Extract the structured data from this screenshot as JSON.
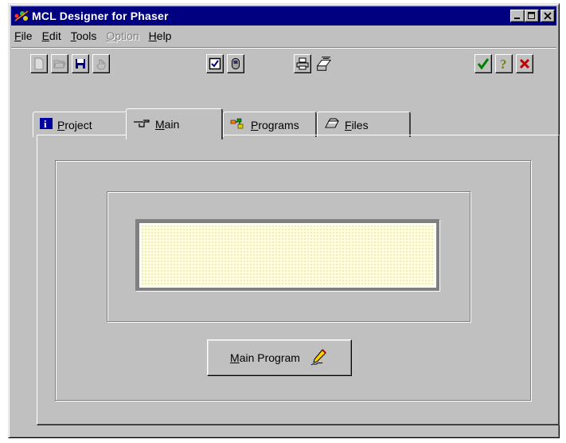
{
  "window": {
    "title": "MCL Designer for Phaser"
  },
  "title_buttons": {
    "minimize": "_",
    "maximize": "□",
    "close": "✕"
  },
  "menu": [
    {
      "label": "File",
      "enabled": true
    },
    {
      "label": "Edit",
      "enabled": true
    },
    {
      "label": "Tools",
      "enabled": true
    },
    {
      "label": "Option",
      "enabled": false
    },
    {
      "label": "Help",
      "enabled": true
    }
  ],
  "toolbar": {
    "icons": [
      "new-file-icon",
      "open-folder-icon",
      "save-disk-icon",
      "hand-pointer-icon",
      "checkbox-icon",
      "device-icon",
      "printer-icon",
      "fax-icon",
      "ok-check-icon",
      "help-question-icon",
      "cancel-x-icon"
    ]
  },
  "tabs": [
    {
      "label": "Project",
      "icon": "info-icon",
      "active": false
    },
    {
      "label": "Main",
      "icon": "pointing-hand-icon",
      "active": true
    },
    {
      "label": "Programs",
      "icon": "programs-icon",
      "active": false
    },
    {
      "label": "Files",
      "icon": "files-icon",
      "active": false
    }
  ],
  "main_panel": {
    "display_value": "",
    "main_program_button": "Main Program"
  },
  "colors": {
    "titlebar": "#000080",
    "face": "#c0c0c0",
    "display_bg": "#fffde0",
    "ok_check": "#008000",
    "cancel_x": "#c00000"
  }
}
